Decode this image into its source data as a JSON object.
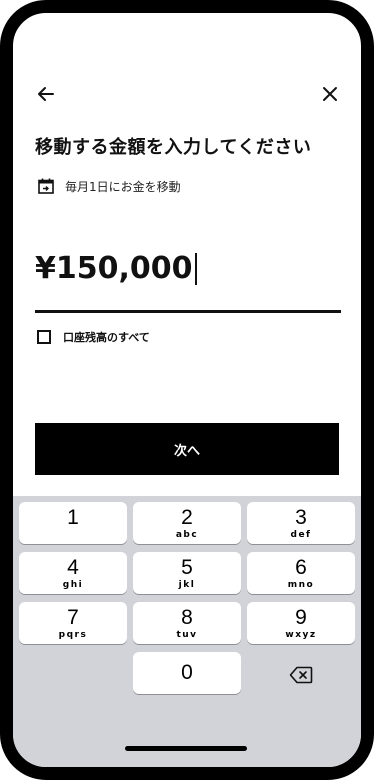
{
  "header": {
    "back_icon": "arrow-left-icon",
    "close_icon": "close-icon"
  },
  "title": "移動する金額を入力してください",
  "schedule": {
    "icon": "calendar-icon",
    "text": "毎月1日にお金を移動"
  },
  "amount": {
    "value": "¥150,000"
  },
  "all_balance": {
    "label": "口座残高のすべて",
    "checked": false
  },
  "next_button": {
    "label": "次へ"
  },
  "keypad": {
    "keys": [
      {
        "num": "1",
        "letters": ""
      },
      {
        "num": "2",
        "letters": "abc"
      },
      {
        "num": "3",
        "letters": "def"
      },
      {
        "num": "4",
        "letters": "ghi"
      },
      {
        "num": "5",
        "letters": "jkl"
      },
      {
        "num": "6",
        "letters": "mno"
      },
      {
        "num": "7",
        "letters": "pqrs"
      },
      {
        "num": "8",
        "letters": "tuv"
      },
      {
        "num": "9",
        "letters": "wxyz"
      },
      {
        "num": "0",
        "letters": ""
      }
    ],
    "delete_icon": "backspace-icon"
  },
  "colors": {
    "primary": "#000000",
    "keypad_bg": "#d1d3d9",
    "key_bg": "#ffffff"
  }
}
